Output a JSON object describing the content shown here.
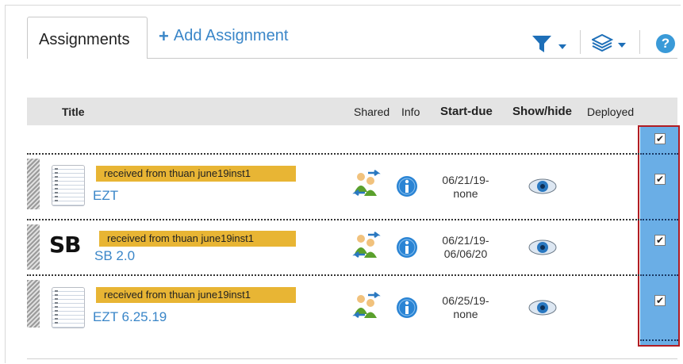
{
  "tabs": {
    "active_label": "Assignments",
    "add_label": "Add Assignment"
  },
  "toolbar": {
    "filter_icon": "filter-icon",
    "layers_icon": "layers-icon",
    "help_icon": "help-icon",
    "help_glyph": "?"
  },
  "table": {
    "headers": {
      "title": "Title",
      "shared": "Shared",
      "info": "Info",
      "start_due": "Start-due",
      "show_hide": "Show/hide",
      "deployed": "Deployed"
    },
    "header_checked": true,
    "rows": [
      {
        "badge": "received from thuan june19inst1",
        "title": "EZT",
        "icon": "notebook",
        "start": "06/21/19-",
        "due": "none",
        "deployed": true
      },
      {
        "badge": "received from thuan june19inst1",
        "title": "SB 2.0",
        "icon": "sb-logo",
        "logo_text": "SB",
        "start": "06/21/19-",
        "due": "06/06/20",
        "deployed": true
      },
      {
        "badge": "received from thuan june19inst1",
        "title": "EZT 6.25.19",
        "icon": "notebook",
        "start": "06/25/19-",
        "due": "none",
        "deployed": true
      }
    ]
  },
  "colors": {
    "link": "#3a86c8",
    "badge": "#e8b534",
    "deployed_bg": "#6aaee6",
    "highlight_border": "#b11d24"
  }
}
